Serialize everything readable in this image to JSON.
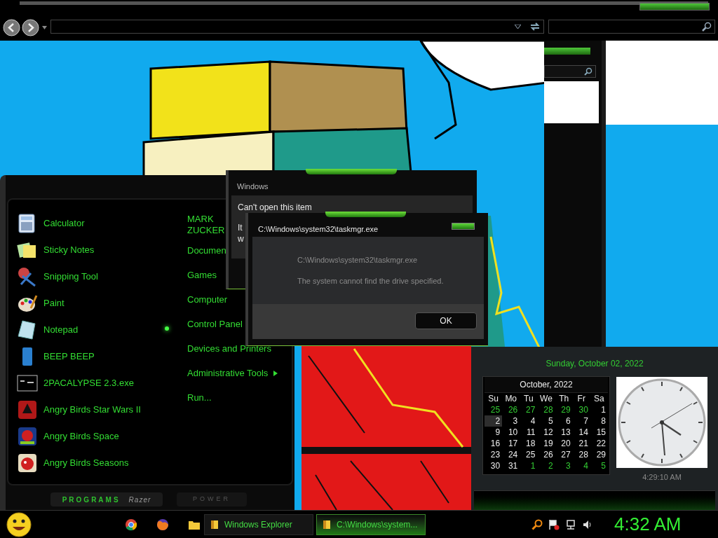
{
  "start_menu": {
    "programs": [
      {
        "label": "Calculator"
      },
      {
        "label": "Sticky Notes"
      },
      {
        "label": "Snipping Tool"
      },
      {
        "label": "Paint"
      },
      {
        "label": "Notepad"
      },
      {
        "label": "BEEP BEEP"
      },
      {
        "label": "2PACALYPSE 2.3.exe"
      },
      {
        "label": "Angry Birds Star Wars II"
      },
      {
        "label": "Angry Birds Space"
      },
      {
        "label": "Angry Birds Seasons"
      }
    ],
    "places": [
      {
        "label": "MARK ZUCKER",
        "kind": "link"
      },
      {
        "label": "Documen",
        "kind": "link"
      },
      {
        "label": "Games",
        "kind": "link"
      },
      {
        "label": "Computer",
        "kind": "link"
      },
      {
        "label": "Control Panel",
        "kind": "link"
      },
      {
        "label": "Devices and Printers",
        "kind": "link"
      },
      {
        "label": "Administrative Tools",
        "kind": "submenu"
      },
      {
        "label": "Run...",
        "kind": "link"
      }
    ],
    "programs_button": "PROGRAMS",
    "brand": "Razer",
    "power_button": "POWER"
  },
  "dialog_back": {
    "title": "Windows",
    "heading": "Can't open this item",
    "body_lines": [
      "It",
      "w"
    ]
  },
  "dialog_front": {
    "title": "C:\\Windows\\system32\\taskmgr.exe",
    "lines": [
      "C:\\Windows\\system32\\taskmgr.exe",
      "The system cannot find the drive specified."
    ],
    "button": "OK"
  },
  "gadget": {
    "date_line": "Sunday, October 02, 2022",
    "month_title": "October, 2022",
    "weekdays": [
      "Su",
      "Mo",
      "Tu",
      "We",
      "Th",
      "Fr",
      "Sa"
    ],
    "days": [
      {
        "day": "25",
        "in_month": false,
        "selected": false
      },
      {
        "day": "26",
        "in_month": false,
        "selected": false
      },
      {
        "day": "27",
        "in_month": false,
        "selected": false
      },
      {
        "day": "28",
        "in_month": false,
        "selected": false
      },
      {
        "day": "29",
        "in_month": false,
        "selected": false
      },
      {
        "day": "30",
        "in_month": false,
        "selected": false
      },
      {
        "day": "1",
        "in_month": true,
        "selected": false
      },
      {
        "day": "2",
        "in_month": true,
        "selected": true
      },
      {
        "day": "3",
        "in_month": true,
        "selected": false
      },
      {
        "day": "4",
        "in_month": true,
        "selected": false
      },
      {
        "day": "5",
        "in_month": true,
        "selected": false
      },
      {
        "day": "6",
        "in_month": true,
        "selected": false
      },
      {
        "day": "7",
        "in_month": true,
        "selected": false
      },
      {
        "day": "8",
        "in_month": true,
        "selected": false
      },
      {
        "day": "9",
        "in_month": true,
        "selected": false
      },
      {
        "day": "10",
        "in_month": true,
        "selected": false
      },
      {
        "day": "11",
        "in_month": true,
        "selected": false
      },
      {
        "day": "12",
        "in_month": true,
        "selected": false
      },
      {
        "day": "13",
        "in_month": true,
        "selected": false
      },
      {
        "day": "14",
        "in_month": true,
        "selected": false
      },
      {
        "day": "15",
        "in_month": true,
        "selected": false
      },
      {
        "day": "16",
        "in_month": true,
        "selected": false
      },
      {
        "day": "17",
        "in_month": true,
        "selected": false
      },
      {
        "day": "18",
        "in_month": true,
        "selected": false
      },
      {
        "day": "19",
        "in_month": true,
        "selected": false
      },
      {
        "day": "20",
        "in_month": true,
        "selected": false
      },
      {
        "day": "21",
        "in_month": true,
        "selected": false
      },
      {
        "day": "22",
        "in_month": true,
        "selected": false
      },
      {
        "day": "23",
        "in_month": true,
        "selected": false
      },
      {
        "day": "24",
        "in_month": true,
        "selected": false
      },
      {
        "day": "25",
        "in_month": true,
        "selected": false
      },
      {
        "day": "26",
        "in_month": true,
        "selected": false
      },
      {
        "day": "27",
        "in_month": true,
        "selected": false
      },
      {
        "day": "28",
        "in_month": true,
        "selected": false
      },
      {
        "day": "29",
        "in_month": true,
        "selected": false
      },
      {
        "day": "30",
        "in_month": true,
        "selected": false
      },
      {
        "day": "31",
        "in_month": true,
        "selected": false
      },
      {
        "day": "1",
        "in_month": false,
        "selected": false
      },
      {
        "day": "2",
        "in_month": false,
        "selected": false
      },
      {
        "day": "3",
        "in_month": false,
        "selected": false
      },
      {
        "day": "4",
        "in_month": false,
        "selected": false
      },
      {
        "day": "5",
        "in_month": false,
        "selected": false
      }
    ],
    "clock_time": "4:29:10 AM"
  },
  "taskbar": {
    "tasks": [
      {
        "label": "Windows Explorer",
        "selected": false
      },
      {
        "label": "C:\\Windows\\system...",
        "selected": true
      }
    ],
    "clock": "4:32 AM"
  }
}
